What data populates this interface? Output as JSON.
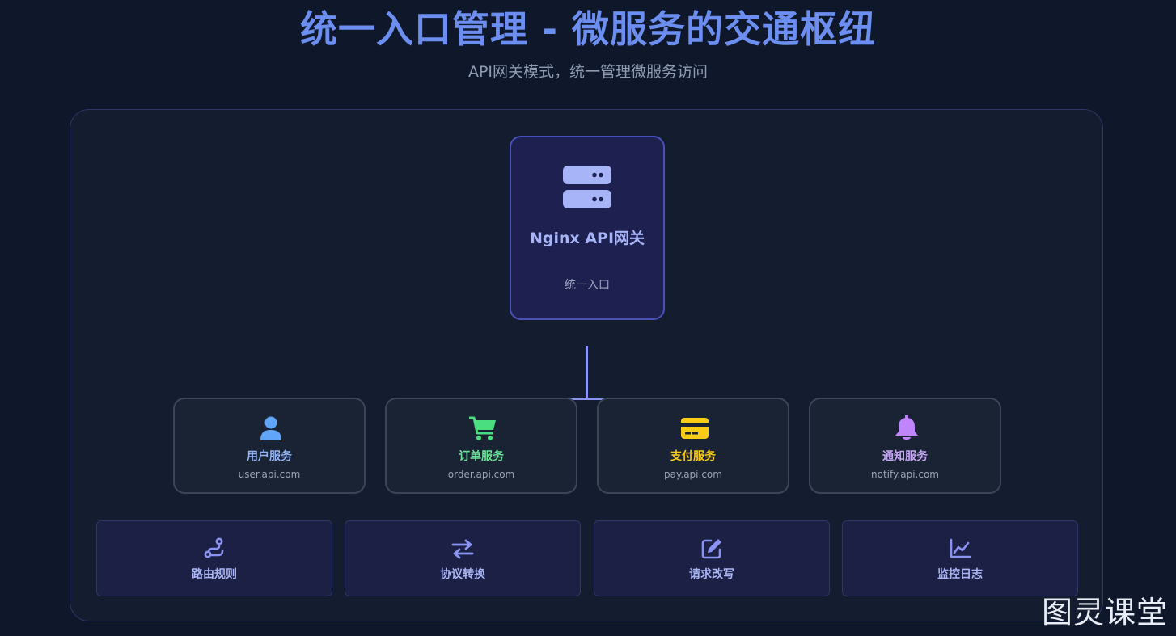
{
  "header": {
    "title": "统一入口管理 - 微服务的交通枢纽",
    "subtitle": "API网关模式，统一管理微服务访问"
  },
  "gateway": {
    "icon": "server-icon",
    "name": "Nginx API网关",
    "subtitle": "统一入口",
    "color": "#a8b4f8"
  },
  "services": [
    {
      "icon": "user-icon",
      "name": "用户服务",
      "host": "user.api.com",
      "color": "#60a5fa"
    },
    {
      "icon": "cart-icon",
      "name": "订单服务",
      "host": "order.api.com",
      "color": "#4ade80"
    },
    {
      "icon": "credit-card-icon",
      "name": "支付服务",
      "host": "pay.api.com",
      "color": "#facc15"
    },
    {
      "icon": "bell-icon",
      "name": "通知服务",
      "host": "notify.api.com",
      "color": "#c084fc"
    }
  ],
  "features": [
    {
      "icon": "route-icon",
      "label": "路由规则"
    },
    {
      "icon": "exchange-icon",
      "label": "协议转换"
    },
    {
      "icon": "edit-icon",
      "label": "请求改写"
    },
    {
      "icon": "chart-line-icon",
      "label": "监控日志"
    }
  ],
  "watermark": "图灵课堂"
}
